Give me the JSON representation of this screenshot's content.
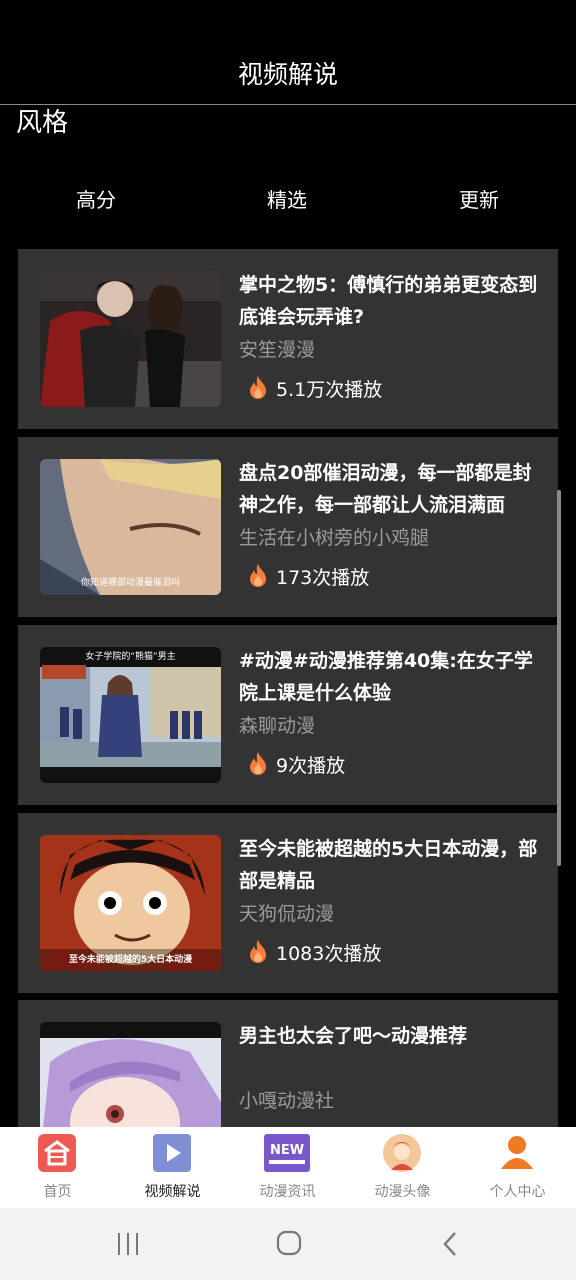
{
  "header": {
    "title": "视频解说"
  },
  "style_label": "风格",
  "filters": [
    "高分",
    "精选",
    "更新"
  ],
  "videos": [
    {
      "title": "掌中之物5：傅慎行的弟弟更变态到底谁会玩弄谁?",
      "author": "安笙漫漫",
      "plays": "5.1万次播放",
      "caption": ""
    },
    {
      "title": "盘点20部催泪动漫，每一部都是封神之作，每一部都让人流泪满面",
      "author": "生活在小树旁的小鸡腿",
      "plays": "173次播放",
      "caption": "你知道哪部动漫最催泪吗"
    },
    {
      "title": "#动漫#动漫推荐第40集:在女子学院上课是什么体验",
      "author": "森聊动漫",
      "plays": "9次播放",
      "caption": "女子学院的“熊猫”男主"
    },
    {
      "title": "至今未能被超越的5大日本动漫，部部是精品",
      "author": "天狗侃动漫",
      "plays": "1083次播放",
      "caption": "至今未能被超越的5大日本动漫"
    },
    {
      "title": "男主也太会了吧～动漫推荐",
      "author": "小嘎动漫社",
      "plays": "",
      "caption": ""
    }
  ],
  "tabs": [
    {
      "label": "首页",
      "icon": "home-icon"
    },
    {
      "label": "视频解说",
      "icon": "play-icon"
    },
    {
      "label": "动漫资讯",
      "icon": "new-badge-icon",
      "badge": "NEW"
    },
    {
      "label": "动漫头像",
      "icon": "avatar-icon"
    },
    {
      "label": "个人中心",
      "icon": "person-icon"
    }
  ],
  "active_tab": "视频解说",
  "colors": {
    "accent_orange": "#f57c3a",
    "card_bg": "#333333",
    "background": "#000000"
  }
}
